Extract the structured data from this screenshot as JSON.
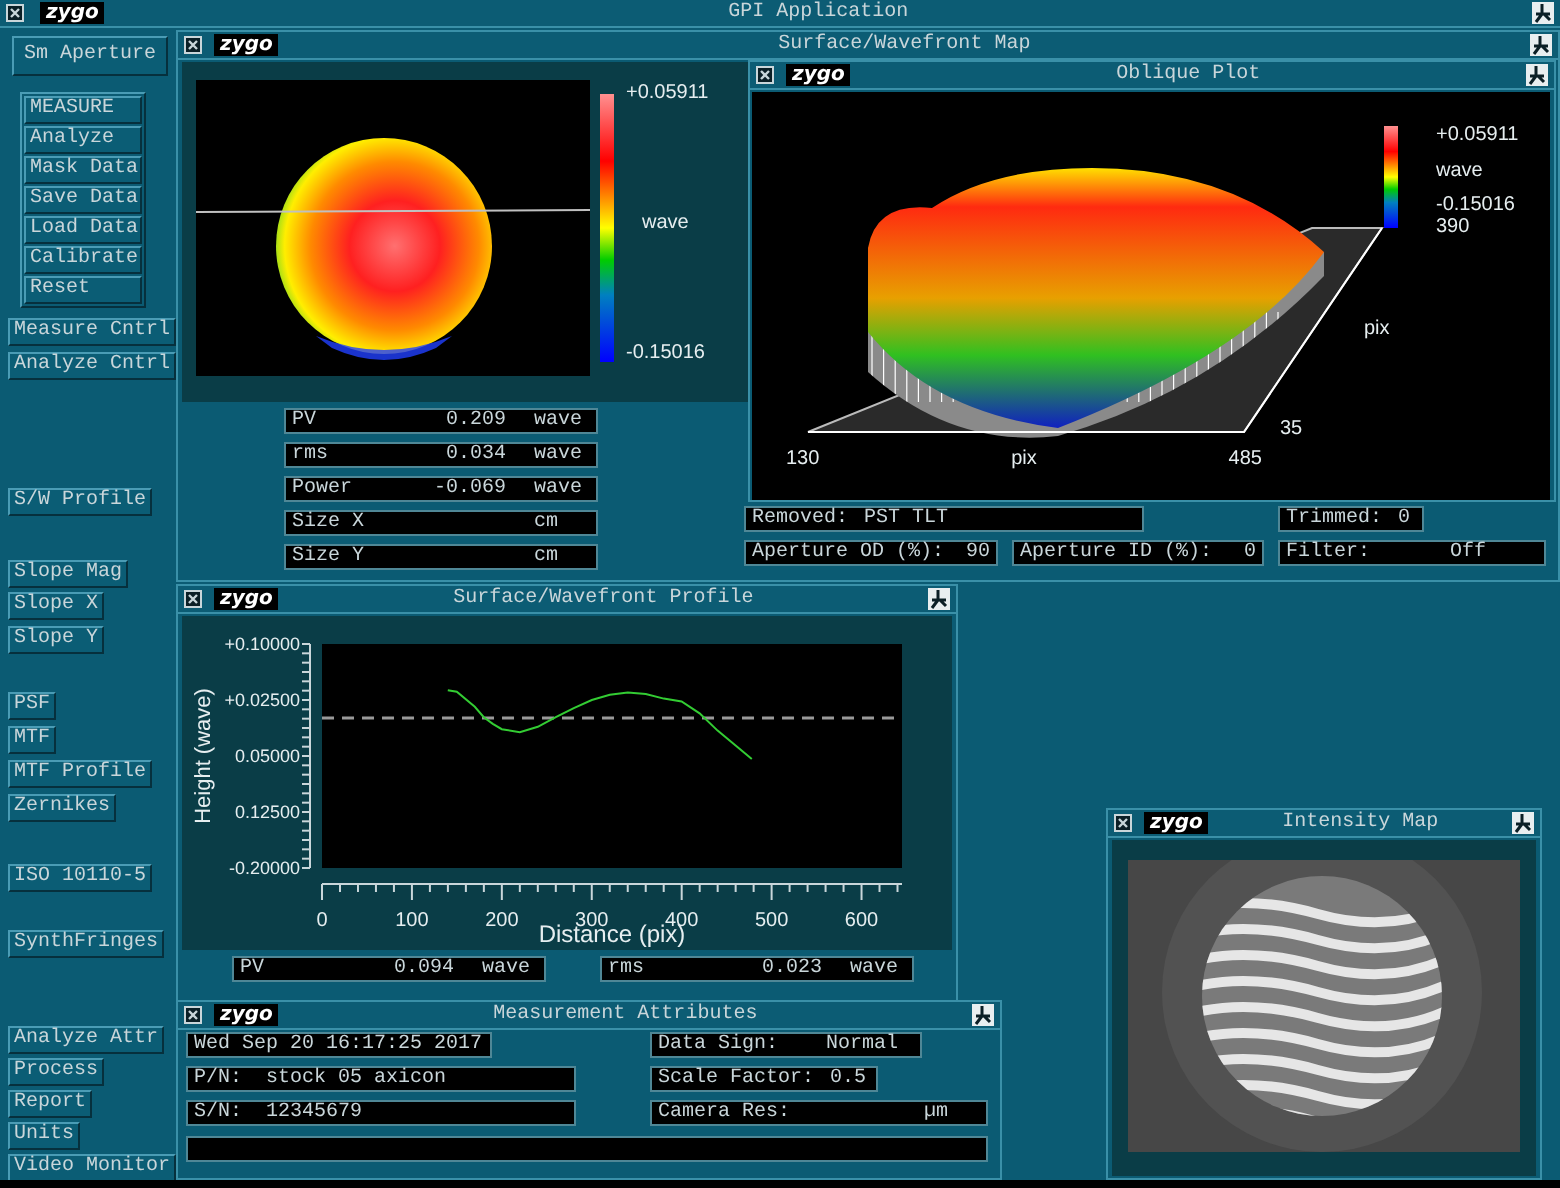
{
  "app": {
    "title": "GPI Application",
    "logo": "zygo"
  },
  "sidebar": {
    "top_button": "Sm Aperture",
    "measure_group": [
      "MEASURE",
      "Analyze",
      "Mask Data",
      "Save Data",
      "Load Data",
      "Calibrate",
      "Reset"
    ],
    "items": [
      "Measure Cntrl",
      "Analyze Cntrl",
      "S/W Profile",
      "Slope Mag",
      "Slope X",
      "Slope Y",
      "PSF",
      "MTF",
      "MTF Profile",
      "Zernikes",
      "ISO 10110-5",
      "SynthFringes",
      "Analyze Attr",
      "Process",
      "Report",
      "Units",
      "Video Monitor"
    ]
  },
  "surface_map": {
    "title": "Surface/Wavefront Map",
    "logo": "zygo",
    "colorbar": {
      "max": "+0.05911",
      "unit": "wave",
      "min": "-0.15016"
    },
    "stats": [
      {
        "label": "PV",
        "value": "0.209",
        "unit": "wave"
      },
      {
        "label": "rms",
        "value": "0.034",
        "unit": "wave"
      },
      {
        "label": "Power",
        "value": "-0.069",
        "unit": "wave"
      },
      {
        "label": "Size X",
        "unit": "cm"
      },
      {
        "label": "Size Y",
        "unit": "cm"
      }
    ],
    "oblique_plot": {
      "title": "Oblique Plot",
      "logo": "zygo",
      "colorbar": {
        "max": "+0.05911",
        "unit": "wave",
        "min": "-0.15016"
      },
      "x_axis": {
        "min": "130",
        "label": "pix",
        "max": "485"
      },
      "y_axis": {
        "min": "35",
        "label": "pix",
        "max": "390"
      }
    },
    "fields": [
      {
        "label": "Removed:",
        "value": "PST TLT"
      },
      {
        "label": "Trimmed:",
        "value": "0"
      },
      {
        "label": "Aperture OD (%):",
        "value": "90"
      },
      {
        "label": "Aperture ID (%):",
        "value": "0"
      },
      {
        "label": "Filter:",
        "value": "Off"
      }
    ]
  },
  "profile": {
    "title": "Surface/Wavefront Profile",
    "logo": "zygo",
    "chart_data": {
      "type": "line",
      "xlabel": "Distance (pix)",
      "ylabel": "Height (wave)",
      "x": [
        140,
        150,
        170,
        180,
        190,
        200,
        220,
        240,
        260,
        280,
        300,
        320,
        340,
        360,
        380,
        400,
        420,
        440,
        460,
        478
      ],
      "series": [
        {
          "color": "#33cc33",
          "values": [
            0.038,
            0.036,
            0.016,
            0.002,
            -0.007,
            -0.014,
            -0.018,
            -0.011,
            0.002,
            0.014,
            0.025,
            0.032,
            0.035,
            0.033,
            0.027,
            0.023,
            0.007,
            -0.016,
            -0.036,
            -0.054
          ]
        }
      ],
      "xlim": [
        0,
        645
      ],
      "ylim": [
        -0.2,
        0.1
      ],
      "xticks": [
        0,
        100,
        200,
        300,
        400,
        500,
        600
      ],
      "yticks": [
        {
          "value": 0.1,
          "label": "+0.10000"
        },
        {
          "value": 0.025,
          "label": "+0.02500"
        },
        {
          "value": -0.05,
          "label": "0.05000"
        },
        {
          "value": -0.125,
          "label": "0.12500"
        },
        {
          "value": -0.2,
          "label": "-0.20000"
        }
      ],
      "ref_lines": [
        {
          "axis": "y",
          "value": 0.001
        }
      ]
    },
    "stats": [
      {
        "label": "PV",
        "value": "0.094",
        "unit": "wave"
      },
      {
        "label": "rms",
        "value": "0.023",
        "unit": "wave"
      }
    ]
  },
  "measurement_attributes": {
    "title": "Measurement Attributes",
    "logo": "zygo",
    "date": "Wed Sep 20 16:17:25 2017",
    "part_number": {
      "label": "P/N:",
      "value": "stock 05 axicon"
    },
    "serial_number": {
      "label": "S/N:",
      "value": "12345679"
    },
    "data_sign": {
      "label": "Data Sign:",
      "value": "Normal"
    },
    "scale_factor": {
      "label": "Scale Factor:",
      "value": "0.5"
    },
    "camera_res": {
      "label": "Camera Res:",
      "unit": "µm"
    }
  },
  "intensity_map": {
    "title": "Intensity Map",
    "logo": "zygo"
  }
}
